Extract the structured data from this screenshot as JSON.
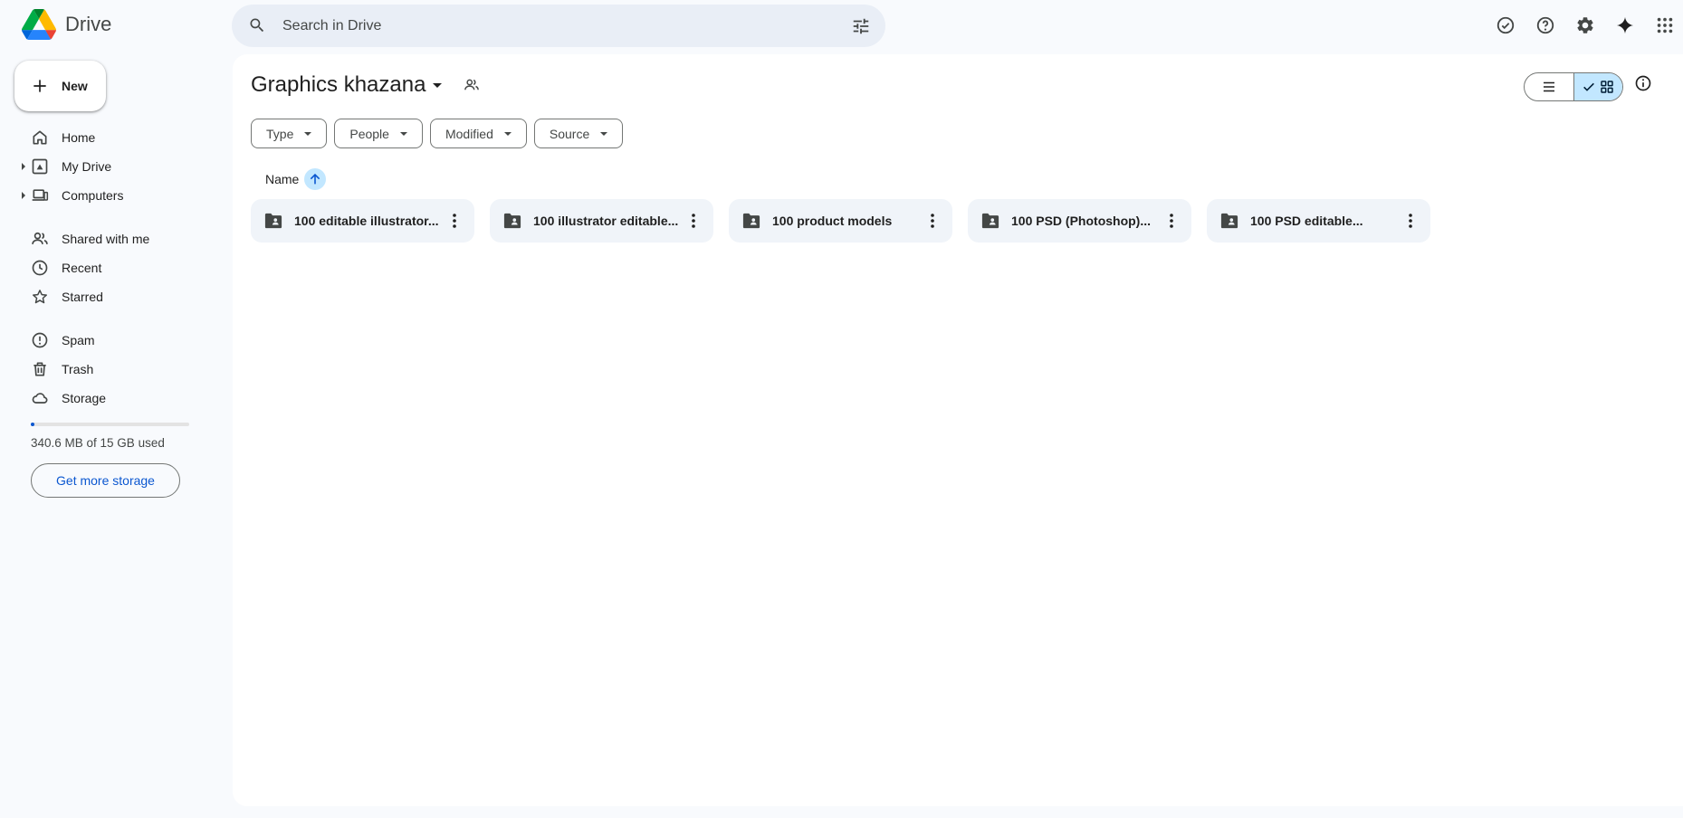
{
  "app": {
    "name": "Drive",
    "logo_colors": [
      "#0066da",
      "#00ac47",
      "#ea4335",
      "#00832d",
      "#2684fc",
      "#ffba00"
    ]
  },
  "search": {
    "placeholder": "Search in Drive"
  },
  "top_actions": [
    {
      "name": "ready-for-offline-icon"
    },
    {
      "name": "help-icon"
    },
    {
      "name": "settings-icon"
    },
    {
      "name": "gemini-icon"
    },
    {
      "name": "apps-grid-icon"
    }
  ],
  "sidebar": {
    "new_label": "New",
    "items": [
      {
        "label": "Home",
        "icon": "home-icon"
      },
      {
        "label": "My Drive",
        "icon": "my-drive-icon",
        "expandable": true
      },
      {
        "label": "Computers",
        "icon": "computers-icon",
        "expandable": true
      },
      {
        "label": "Shared with me",
        "icon": "shared-icon"
      },
      {
        "label": "Recent",
        "icon": "clock-icon"
      },
      {
        "label": "Starred",
        "icon": "star-icon"
      },
      {
        "label": "Spam",
        "icon": "spam-icon"
      },
      {
        "label": "Trash",
        "icon": "trash-icon"
      },
      {
        "label": "Storage",
        "icon": "cloud-icon"
      }
    ],
    "storage": {
      "used_text": "340.6 MB of 15 GB used",
      "used_fraction": 0.0227,
      "button_label": "Get more storage"
    }
  },
  "main": {
    "title": "Graphics khazana",
    "view": "grid",
    "filters": [
      {
        "label": "Type"
      },
      {
        "label": "People"
      },
      {
        "label": "Modified"
      },
      {
        "label": "Source"
      }
    ],
    "sort": {
      "label": "Name",
      "direction": "ascending"
    },
    "folders": [
      {
        "name": "100 editable illustrator..."
      },
      {
        "name": "100 illustrator editable..."
      },
      {
        "name": "100 product models"
      },
      {
        "name": "100 PSD (Photoshop)..."
      },
      {
        "name": "100 PSD editable..."
      }
    ]
  },
  "colors": {
    "accent": "#0b57d0",
    "selected": "#c2e7ff",
    "surface": "#f8fafd",
    "folder_card": "#f0f4f9"
  }
}
